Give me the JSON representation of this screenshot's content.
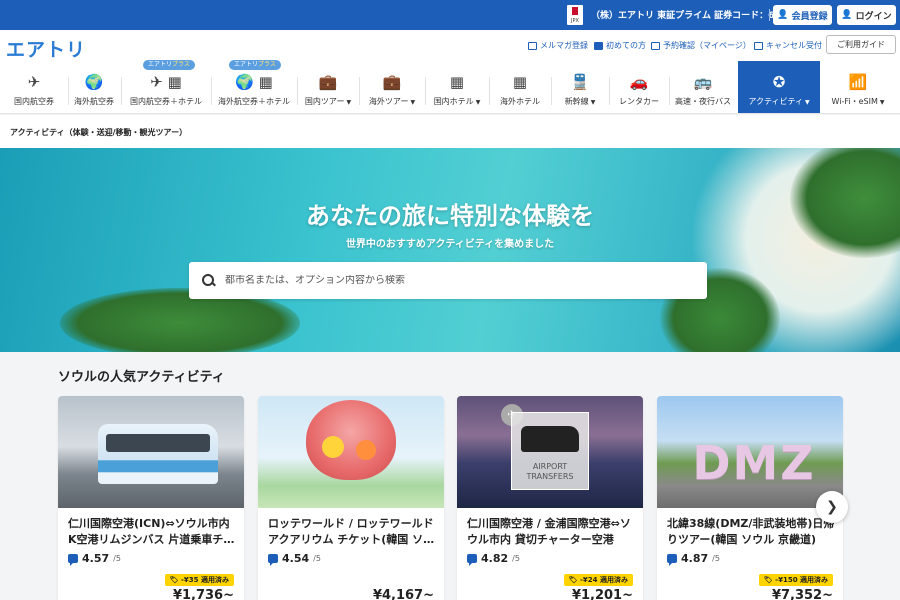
{
  "topbar": {
    "jpx_label": "JPX",
    "company": "（株）エアトリ 東証プライム 証券コード：6191",
    "register_label": "会員登録",
    "login_label": "ログイン"
  },
  "header": {
    "logo": "エアトリ",
    "util_links": [
      "メルマガ登録",
      "初めての方",
      "予約確認（マイページ）",
      "キャンセル受付"
    ],
    "guide_label": "ご利用ガイド",
    "plus_badge_prefix": "エアトリ",
    "plus_badge_suffix": "プラス"
  },
  "nav": {
    "items": [
      {
        "label": "国内航空券",
        "icon": "plane-icon"
      },
      {
        "label": "海外航空券",
        "icon": "globe-plane-icon"
      },
      {
        "label": "国内航空券＋ホテル",
        "icon": "plane-hotel-icon"
      },
      {
        "label": "海外航空券＋ホテル",
        "icon": "globe-hotel-icon"
      },
      {
        "label": "国内ツアー",
        "icon": "suitcase-icon"
      },
      {
        "label": "海外ツアー",
        "icon": "suitcase-icon"
      },
      {
        "label": "国内ホテル",
        "icon": "hotel-icon"
      },
      {
        "label": "海外ホテル",
        "icon": "hotel-icon"
      },
      {
        "label": "新幹線",
        "icon": "train-icon"
      },
      {
        "label": "レンタカー",
        "icon": "car-icon"
      },
      {
        "label": "高速・夜行バス",
        "icon": "bus-icon"
      },
      {
        "label": "アクティビティ",
        "icon": "activity-icon"
      },
      {
        "label": "Wi-Fi・eSIM",
        "icon": "wifi-icon"
      }
    ]
  },
  "breadcrumb": "アクティビティ（体験・送迎/移動・観光ツアー）",
  "hero": {
    "title": "あなたの旅に特別な体験を",
    "subtitle": "世界中のおすすめアクティビティを集めました",
    "search_placeholder": "都市名または、オプション内容から検索"
  },
  "section": {
    "title": "ソウルの人気アクティビティ",
    "cards": [
      {
        "title": "仁川国際空港(ICN)⇔ソウル市内 K空港リムジンバス 片道乗車チ…",
        "rating": "4.57",
        "rating_of": "/5",
        "coupon": "-¥35 適用済み",
        "price": "¥1,736~"
      },
      {
        "title": "ロッテワールド / ロッテワールド アクアリウム チケット(韓国 ソ…",
        "rating": "4.54",
        "rating_of": "/5",
        "coupon": "",
        "price": "¥4,167~"
      },
      {
        "title": "仁川国際空港 / 金浦国際空港⇔ソ ウル市内 貸切チャーター空港送…",
        "rating": "4.82",
        "rating_of": "/5",
        "coupon": "-¥24 適用済み",
        "price": "¥1,201~"
      },
      {
        "title": "北緯38線(DMZ/非武装地帯)日帰りツアー(韓国 ソウル 京畿道)",
        "rating": "4.87",
        "rating_of": "/5",
        "coupon": "-¥150 適用済み",
        "price": "¥7,352~"
      }
    ],
    "card3_image_text": "AIRPORT TRANSFERS",
    "card4_image_text": "DMZ"
  }
}
